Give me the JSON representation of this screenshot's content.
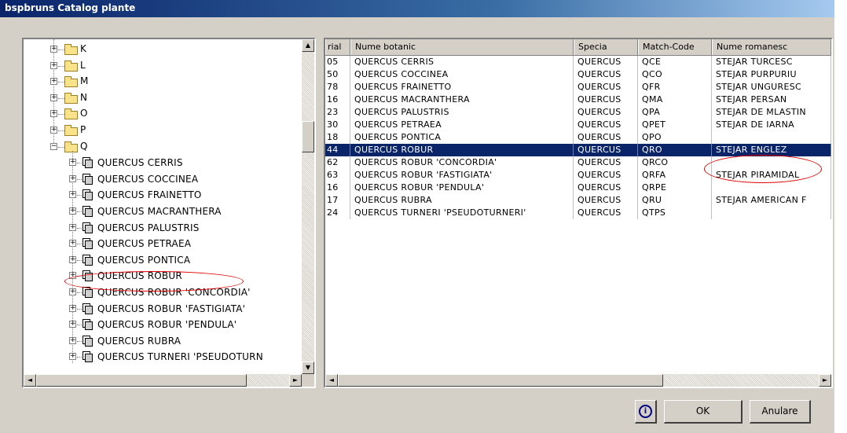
{
  "window": {
    "title": "bspbruns Catalog plante"
  },
  "tree": {
    "folders": [
      "K",
      "L",
      "M",
      "N",
      "O",
      "P",
      "Q"
    ],
    "items": [
      "QUERCUS CERRIS",
      "QUERCUS COCCINEA",
      "QUERCUS FRAINETTO",
      "QUERCUS MACRANTHERA",
      "QUERCUS PALUSTRIS",
      "QUERCUS PETRAEA",
      "QUERCUS PONTICA",
      "QUERCUS ROBUR",
      "QUERCUS ROBUR 'CONCORDIA'",
      "QUERCUS ROBUR 'FASTIGIATA'",
      "QUERCUS ROBUR 'PENDULA'",
      "QUERCUS RUBRA",
      "QUERCUS TURNERI 'PSEUDOTURN"
    ],
    "expander_plus": "+",
    "expander_minus": "−",
    "scroll_up_icon": "▲",
    "scroll_down_icon": "▼",
    "scroll_left_icon": "◄",
    "scroll_right_icon": "►"
  },
  "grid": {
    "columns": [
      "rial",
      "Nume botanic",
      "Specia",
      "Match-Code",
      "Nume romanesc"
    ],
    "rows": [
      [
        "05",
        "QUERCUS CERRIS",
        "QUERCUS",
        "QCE",
        "STEJAR TURCESC"
      ],
      [
        "50",
        "QUERCUS COCCINEA",
        "QUERCUS",
        "QCO",
        "STEJAR PURPURIU"
      ],
      [
        "78",
        "QUERCUS FRAINETTO",
        "QUERCUS",
        "QFR",
        "STEJAR UNGURESC"
      ],
      [
        "16",
        "QUERCUS MACRANTHERA",
        "QUERCUS",
        "QMA",
        "STEJAR PERSAN"
      ],
      [
        "23",
        "QUERCUS PALUSTRIS",
        "QUERCUS",
        "QPA",
        "STEJAR DE MLASTIN"
      ],
      [
        "30",
        "QUERCUS PETRAEA",
        "QUERCUS",
        "QPET",
        "STEJAR DE IARNA"
      ],
      [
        "18",
        "QUERCUS PONTICA",
        "QUERCUS",
        "QPO",
        ""
      ],
      [
        "44",
        "QUERCUS ROBUR",
        "QUERCUS",
        "QRO",
        "STEJAR ENGLEZ"
      ],
      [
        "62",
        "QUERCUS ROBUR 'CONCORDIA'",
        "QUERCUS",
        "QRCO",
        ""
      ],
      [
        "63",
        "QUERCUS ROBUR 'FASTIGIATA'",
        "QUERCUS",
        "QRFA",
        "STEJAR PIRAMIDAL"
      ],
      [
        "16",
        "QUERCUS ROBUR 'PENDULA'",
        "QUERCUS",
        "QRPE",
        ""
      ],
      [
        "17",
        "QUERCUS RUBRA",
        "QUERCUS",
        "QRU",
        "STEJAR AMERICAN F"
      ],
      [
        "24",
        "QUERCUS TURNERI 'PSEUDOTURNERI'",
        "QUERCUS",
        "QTPS",
        ""
      ]
    ],
    "selected_row": 7
  },
  "buttons": {
    "info_icon": "i",
    "ok": "OK",
    "cancel": "Anulare"
  },
  "colors": {
    "selection": "#0a246a",
    "annotation": "#e00000",
    "title_bar": "#0a246a"
  }
}
